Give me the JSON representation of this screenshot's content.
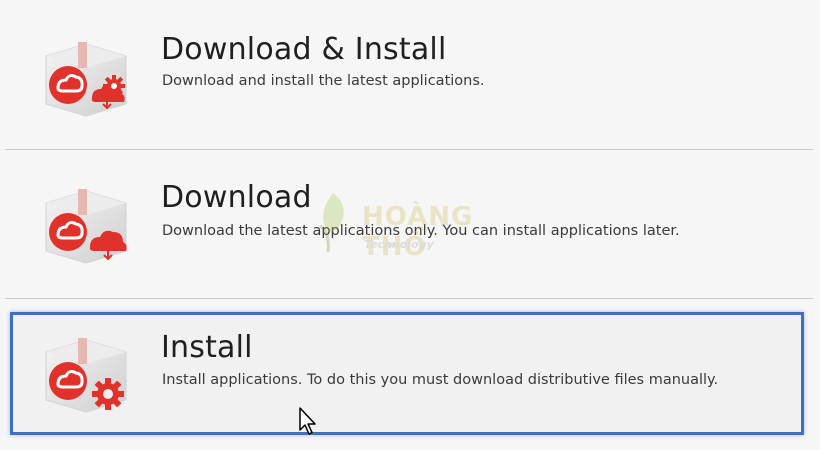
{
  "options": [
    {
      "title": "Download & Install",
      "description": "Download and install the latest applications.",
      "icon": "creative-cloud-package-download-install-icon"
    },
    {
      "title": "Download",
      "description": "Download the latest applications only. You can install applications later.",
      "icon": "creative-cloud-package-download-icon"
    },
    {
      "title": "Install",
      "description": "Install applications. To do this you must download distributive files manually.",
      "icon": "creative-cloud-package-install-icon"
    }
  ],
  "selected_index": 2,
  "watermark": {
    "brand": "HOÀNG THỔ",
    "sub": "Technology"
  },
  "colors": {
    "accent_red": "#e0312b",
    "selection_border": "#3f6fc2",
    "background": "#f6f6f6"
  }
}
